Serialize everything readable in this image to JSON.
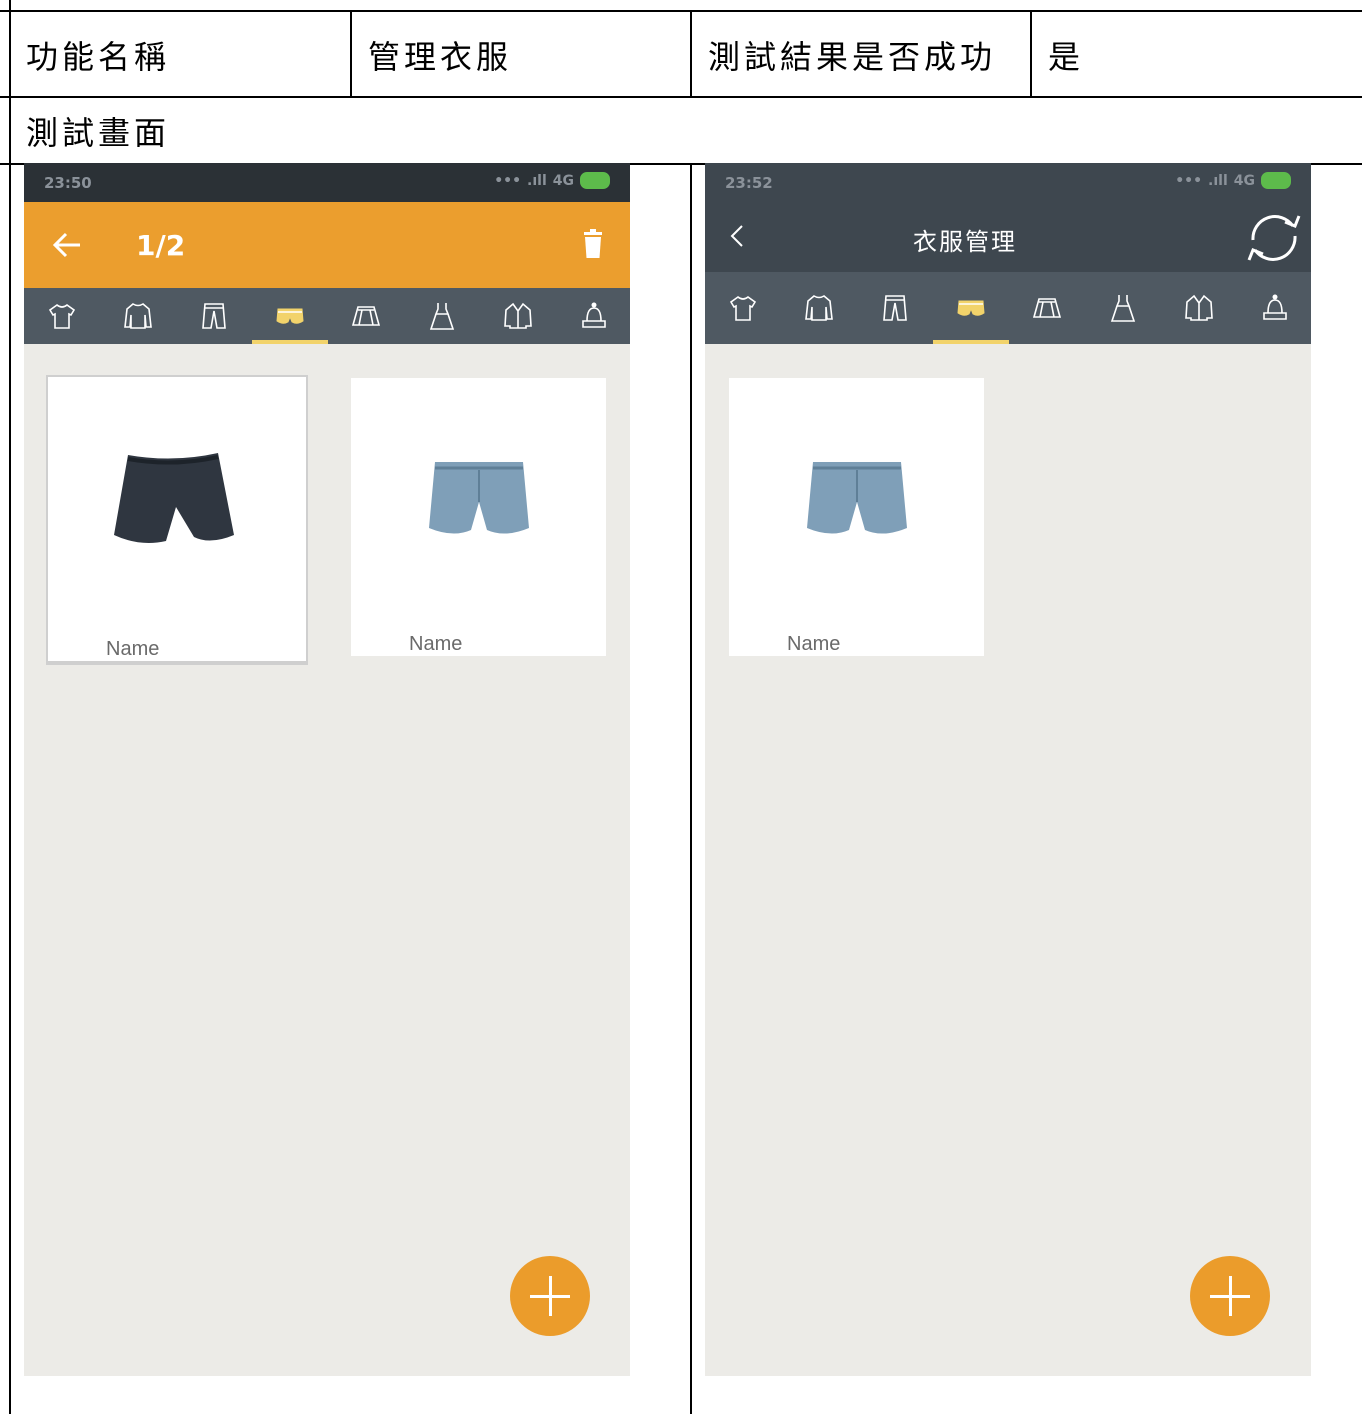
{
  "table": {
    "header_row": {
      "feature_label": "功能名稱",
      "feature_value": "管理衣服",
      "result_label": "測試結果是否成功",
      "result_value": "是"
    },
    "screens_label": "測試畫面"
  },
  "left_phone": {
    "status_time": "23:50",
    "status_network": "4G",
    "appbar_color": "#eb9e2e",
    "selection_count": "1/2",
    "icons": {
      "back": "arrow-left-icon",
      "delete": "trash-icon"
    },
    "tabs": [
      "t-shirt-icon",
      "sweater-icon",
      "pants-icon",
      "shorts-icon",
      "skirt-icon",
      "dress-icon",
      "jacket-icon",
      "hat-icon"
    ],
    "selected_tab_index": 3,
    "items": [
      {
        "name": "Name",
        "image": "black-shorts",
        "selected": true
      },
      {
        "name": "Name",
        "image": "denim-shorts",
        "selected": false
      }
    ],
    "fab_icon": "plus-icon"
  },
  "right_phone": {
    "status_time": "23:52",
    "status_network": "4G",
    "appbar_color": "#3e474f",
    "title": "衣服管理",
    "icons": {
      "back": "chevron-left-icon",
      "sync": "sync-icon"
    },
    "tabs": [
      "t-shirt-icon",
      "sweater-icon",
      "pants-icon",
      "shorts-icon",
      "skirt-icon",
      "dress-icon",
      "jacket-icon",
      "hat-icon"
    ],
    "selected_tab_index": 3,
    "items": [
      {
        "name": "Name",
        "image": "denim-shorts",
        "selected": false
      }
    ],
    "fab_icon": "plus-icon"
  }
}
